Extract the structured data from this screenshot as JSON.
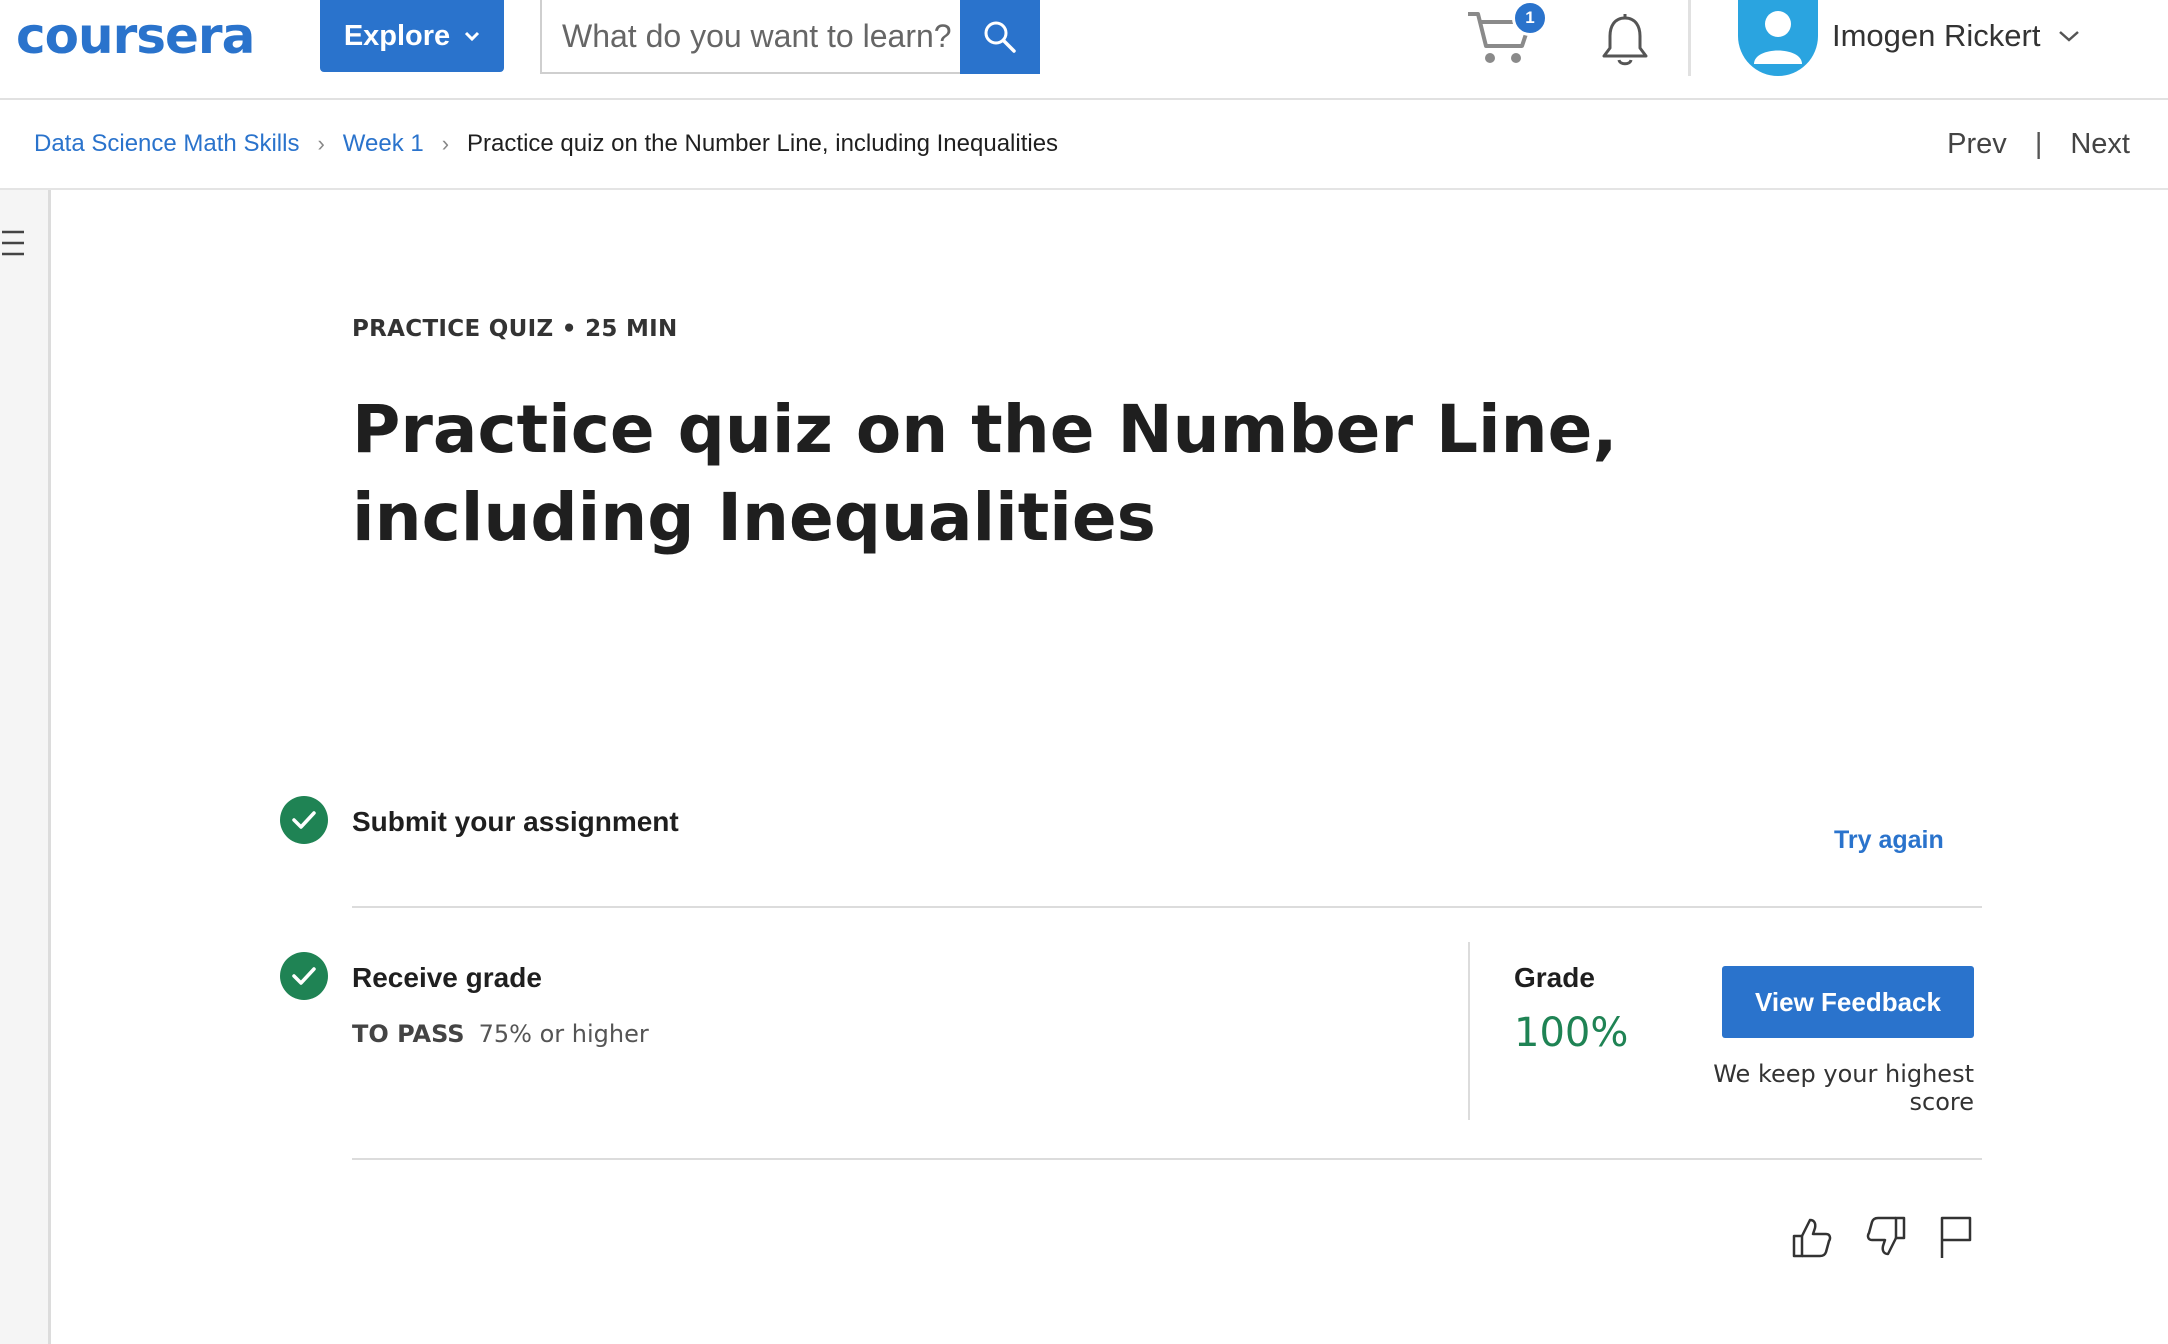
{
  "header": {
    "logo_text": "coursera",
    "explore_label": "Explore",
    "search_placeholder": "What do you want to learn?",
    "cart_count": "1",
    "user_name": "Imogen Rickert"
  },
  "breadcrumb": {
    "items": [
      "Data Science Math Skills",
      "Week 1"
    ],
    "current": "Practice quiz on the Number Line, including Inequalities",
    "prev_label": "Prev",
    "next_label": "Next"
  },
  "quiz": {
    "meta": "PRACTICE QUIZ • 25 MIN",
    "title": "Practice quiz on the Number Line, including Inequalities",
    "submit_label": "Submit your assignment",
    "try_again_label": "Try again",
    "receive_label": "Receive grade",
    "to_pass_label": "TO PASS",
    "to_pass_value": "75% or higher",
    "grade_label": "Grade",
    "grade_value": "100%",
    "view_feedback_label": "View Feedback",
    "keep_note": "We keep your highest score"
  },
  "colors": {
    "brand": "#2a73cc",
    "success": "#1f8354"
  },
  "icons": [
    "chevron-down-icon",
    "search-icon",
    "cart-icon",
    "bell-icon",
    "user-icon",
    "menu-icon",
    "check-icon",
    "thumbs-up-icon",
    "thumbs-down-icon",
    "flag-icon"
  ]
}
